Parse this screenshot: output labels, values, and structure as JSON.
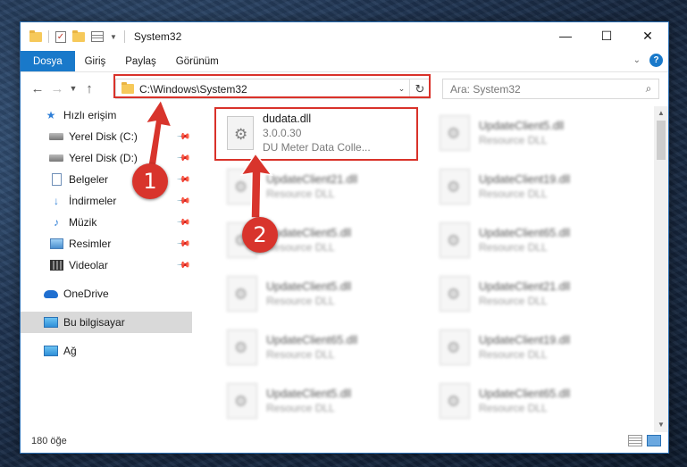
{
  "window": {
    "title": "System32",
    "controls": {
      "minimize": "—",
      "maximize": "☐",
      "close": "✕"
    }
  },
  "ribbon": {
    "tabs": [
      "Dosya",
      "Giriş",
      "Paylaş",
      "Görünüm"
    ],
    "help": "?"
  },
  "navbar": {
    "address": "C:\\Windows\\System32",
    "search_placeholder": "Ara: System32"
  },
  "sidebar": {
    "quick_access": "Hızlı erişim",
    "pinned": [
      "Yerel Disk (C:)",
      "Yerel Disk (D:)",
      "Belgeler",
      "İndirmeler",
      "Müzik",
      "Resimler",
      "Videolar"
    ],
    "onedrive": "OneDrive",
    "this_pc": "Bu bilgisayar",
    "network": "Ağ"
  },
  "files": {
    "highlighted": {
      "name": "dudata.dll",
      "version": "3.0.0.30",
      "description": "DU Meter Data Colle..."
    },
    "left_column": [
      {
        "name": "UpdateClient21.dll",
        "type": "Resource DLL"
      },
      {
        "name": "UpdateClient5.dll",
        "type": "Resource DLL"
      },
      {
        "name": "UpdateClient5.dll",
        "type": "Resource DLL"
      },
      {
        "name": "UpdateClient65.dll",
        "type": "Resource DLL"
      },
      {
        "name": "UpdateClient5.dll",
        "type": "Resource DLL"
      }
    ],
    "right_column": [
      {
        "name": "UpdateClient5.dll",
        "type": "Resource DLL"
      },
      {
        "name": "UpdateClient19.dll",
        "type": "Resource DLL"
      },
      {
        "name": "UpdateClient65.dll",
        "type": "Resource DLL"
      },
      {
        "name": "UpdateClient21.dll",
        "type": "Resource DLL"
      },
      {
        "name": "UpdateClient19.dll",
        "type": "Resource DLL"
      },
      {
        "name": "UpdateClient65.dll",
        "type": "Resource DLL"
      }
    ]
  },
  "status": {
    "item_count": "180 öğe"
  },
  "annotations": {
    "step1": "1",
    "step2": "2",
    "highlight_color": "#d9322a"
  }
}
